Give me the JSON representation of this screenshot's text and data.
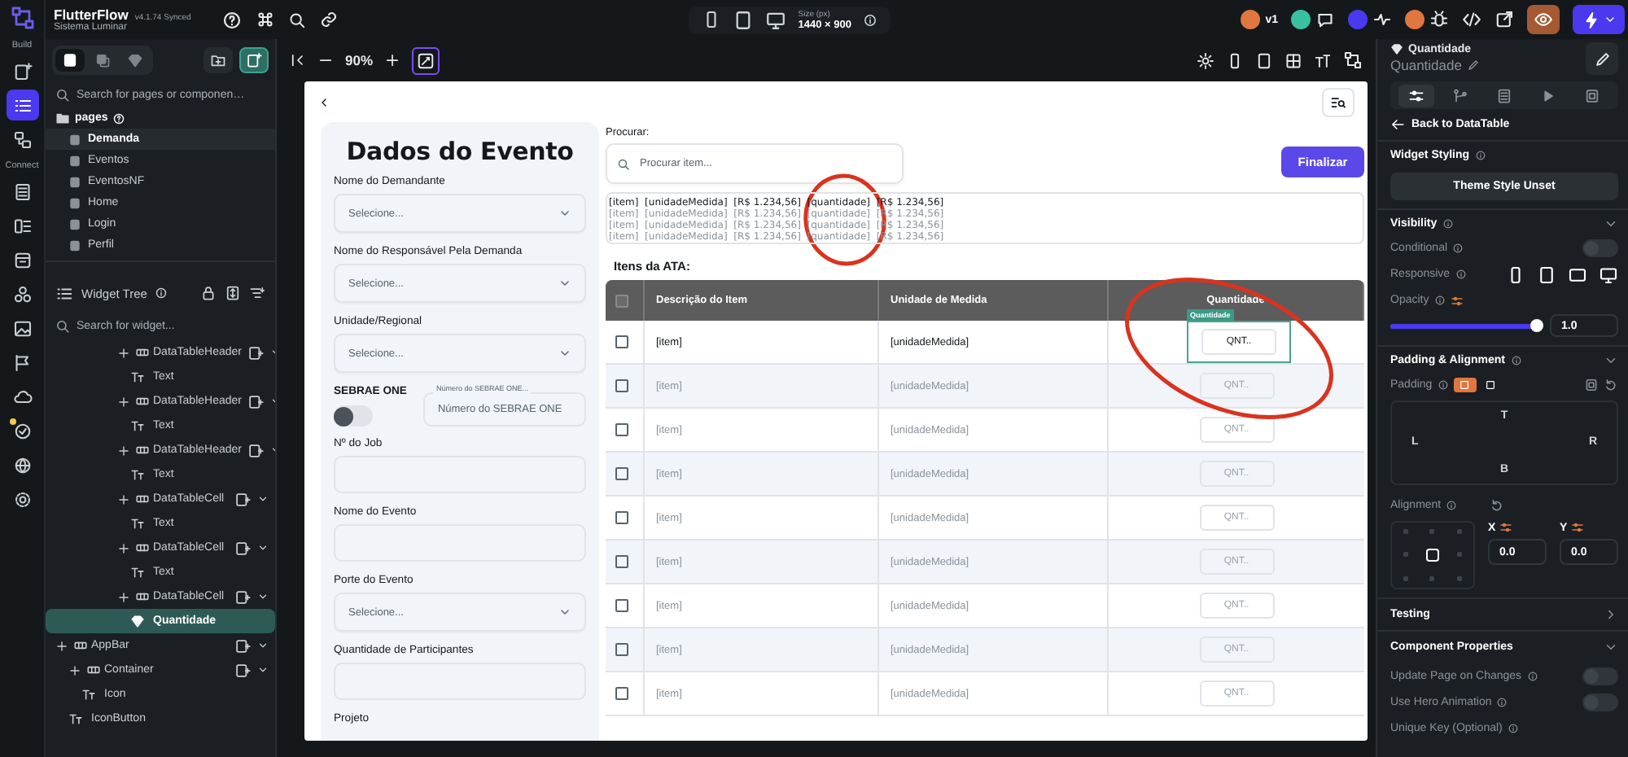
{
  "app": {
    "name": "FlutterFlow",
    "version": "v4.1.74",
    "status": "Synced",
    "project": "Sistema Luminar"
  },
  "rail": {
    "sections": [
      {
        "label": "Build",
        "items": [
          {
            "selected": false,
            "notification": false
          },
          {
            "selected": true,
            "notification": false
          },
          {
            "selected": false,
            "notification": false
          }
        ]
      },
      {
        "label": "Connect",
        "items": [
          {
            "selected": false,
            "notification": false
          },
          {
            "selected": false,
            "notification": false
          },
          {
            "selected": false,
            "notification": false
          },
          {
            "selected": false,
            "notification": false
          },
          {
            "selected": false,
            "notification": false
          },
          {
            "selected": false,
            "notification": false
          },
          {
            "selected": false,
            "notification": false
          },
          {
            "selected": false,
            "notification": true
          },
          {
            "selected": false,
            "notification": false
          },
          {
            "selected": false,
            "notification": false
          }
        ]
      }
    ]
  },
  "topbar": {
    "size_label": "Size (px)",
    "size_value": "1440 × 900",
    "version_label": "v1"
  },
  "left_panel": {
    "search_placeholder": "Search for pages or componen…",
    "pages_label": "pages",
    "pages": [
      {
        "label": "Demanda",
        "selected": true
      },
      {
        "label": "Eventos",
        "selected": false
      },
      {
        "label": "EventosNF",
        "selected": false
      },
      {
        "label": "Home",
        "selected": false
      },
      {
        "label": "Login",
        "selected": false
      },
      {
        "label": "Perfil",
        "selected": false
      }
    ],
    "widget_tree": {
      "title": "Widget Tree",
      "search_placeholder": "Search for widget...",
      "nested_rows": [
        {
          "label": "DataTableHeader",
          "selected": false,
          "children": [
            {
              "label": "Text",
              "selected": false
            }
          ]
        },
        {
          "label": "DataTableHeader",
          "selected": false,
          "children": [
            {
              "label": "Text",
              "selected": false
            }
          ]
        },
        {
          "label": "DataTableHeader",
          "selected": false,
          "children": [
            {
              "label": "Text",
              "selected": false
            }
          ]
        },
        {
          "label": "DataTableCell",
          "selected": false,
          "children": [
            {
              "label": "Text",
              "selected": false
            }
          ]
        },
        {
          "label": "DataTableCell",
          "selected": false,
          "children": [
            {
              "label": "Text",
              "selected": false
            }
          ]
        },
        {
          "label": "DataTableCell",
          "selected": false,
          "children": [
            {
              "label": "Quantidade",
              "selected": true
            }
          ]
        }
      ],
      "rows": [
        {
          "label": "AppBar",
          "selected": false,
          "children": [
            {
              "label": "Container",
              "selected": false,
              "children": [
                {
                  "label": "Icon",
                  "selected": false
                }
              ]
            },
            {
              "label": "IconButton",
              "selected": false
            }
          ]
        }
      ]
    }
  },
  "canvas": {
    "zoom": "90%",
    "form": {
      "title": "Dados do Evento",
      "fields": [
        {
          "kind": "dropdown",
          "label": "Nome do Demandante",
          "placeholder": "Selecione..."
        },
        {
          "kind": "dropdown",
          "label": "Nome do Responsável Pela Demanda",
          "placeholder": "Selecione..."
        },
        {
          "kind": "dropdown",
          "label": "Unidade/Regional",
          "placeholder": "Selecione..."
        },
        {
          "kind": "switch",
          "label": "SEBRAE ONE",
          "on": false,
          "field_label": "Número do SEBRAE ONE...",
          "field_placeholder": "Número do SEBRAE ONE"
        },
        {
          "kind": "text",
          "label": "Nº do Job"
        },
        {
          "kind": "text",
          "label": "Nome do Evento"
        },
        {
          "kind": "dropdown",
          "label": "Porte do Evento",
          "placeholder": "Selecione..."
        },
        {
          "kind": "text",
          "label": "Quantidade de Participantes"
        },
        {
          "kind": "heading",
          "label": "Projeto"
        }
      ]
    },
    "search": {
      "label": "Procurar:",
      "placeholder": "Procurar item..."
    },
    "finalize_button": "Finalizar",
    "preview_lines": [
      {
        "text": "[item]  [unidadeMedida]  [R$ 1.234,56]  [quantidade]  [R$ 1.234,56]",
        "dimmed": false
      },
      {
        "text": "[item]  [unidadeMedida]  [R$ 1.234,56]  [quantidade]  [R$ 1.234,56]",
        "dimmed": true
      },
      {
        "text": "[item]  [unidadeMedida]  [R$ 1.234,56]  [quantidade]  [R$ 1.234,56]",
        "dimmed": true
      },
      {
        "text": "[item]  [unidadeMedida]  [R$ 1.234,56]  [quantidade]  [R$ 1.234,56]",
        "dimmed": true
      }
    ],
    "table": {
      "title": "Itens da ATA:",
      "columns": [
        "Descrição do Item",
        "Unidade de Medida",
        "Quantidade"
      ],
      "header_checked": false,
      "selection_tag": "Quantidade",
      "rows": [
        {
          "item": "[item]",
          "unit": "[unidadeMedida]",
          "quantity_placeholder": "QNT..",
          "checked": false,
          "dimmed": false,
          "selected": true
        },
        {
          "item": "[item]",
          "unit": "[unidadeMedida]",
          "quantity_placeholder": "QNT..",
          "checked": false,
          "dimmed": true,
          "selected": false
        },
        {
          "item": "[item]",
          "unit": "[unidadeMedida]",
          "quantity_placeholder": "QNT..",
          "checked": false,
          "dimmed": true,
          "selected": false
        },
        {
          "item": "[item]",
          "unit": "[unidadeMedida]",
          "quantity_placeholder": "QNT..",
          "checked": false,
          "dimmed": true,
          "selected": false
        },
        {
          "item": "[item]",
          "unit": "[unidadeMedida]",
          "quantity_placeholder": "QNT..",
          "checked": false,
          "dimmed": true,
          "selected": false
        },
        {
          "item": "[item]",
          "unit": "[unidadeMedida]",
          "quantity_placeholder": "QNT..",
          "checked": false,
          "dimmed": true,
          "selected": false
        },
        {
          "item": "[item]",
          "unit": "[unidadeMedida]",
          "quantity_placeholder": "QNT..",
          "checked": false,
          "dimmed": true,
          "selected": false
        },
        {
          "item": "[item]",
          "unit": "[unidadeMedida]",
          "quantity_placeholder": "QNT..",
          "checked": false,
          "dimmed": true,
          "selected": false
        },
        {
          "item": "[item]",
          "unit": "[unidadeMedida]",
          "quantity_placeholder": "QNT..",
          "checked": false,
          "dimmed": true,
          "selected": false
        }
      ]
    },
    "annotations": [
      {
        "kind": "ellipse",
        "color": "#d9331f"
      },
      {
        "kind": "ellipse",
        "color": "#d9331f"
      }
    ]
  },
  "right_panel": {
    "widget_type": "Quantidade",
    "widget_name": "Quantidade",
    "tabs": [
      {
        "selected": true
      },
      {
        "selected": false
      },
      {
        "selected": false
      },
      {
        "selected": false
      },
      {
        "selected": false
      }
    ],
    "back_link": "Back to DataTable",
    "widget_styling": {
      "title": "Widget Styling",
      "button": "Theme Style Unset"
    },
    "visibility": {
      "title": "Visibility",
      "expanded": true,
      "conditional": {
        "label": "Conditional",
        "on": false
      },
      "responsive_label": "Responsive",
      "opacity": {
        "label": "Opacity",
        "level": 1.0,
        "reading": "1.0"
      }
    },
    "padding_alignment": {
      "title": "Padding & Alignment",
      "expanded": true,
      "padding_label": "Padding",
      "sides": [
        "T",
        "L",
        "R",
        "B"
      ],
      "alignment_label": "Alignment",
      "x": {
        "label": "X",
        "value": "0.0"
      },
      "y": {
        "label": "Y",
        "value": "0.0"
      }
    },
    "testing": {
      "title": "Testing",
      "expanded": false
    },
    "component_properties": {
      "title": "Component Properties",
      "expanded": true,
      "toggles": [
        {
          "label": "Update Page on Changes",
          "on": false
        },
        {
          "label": "Use Hero Animation",
          "on": false
        }
      ],
      "unique_key_label": "Unique Key (Optional)"
    }
  }
}
